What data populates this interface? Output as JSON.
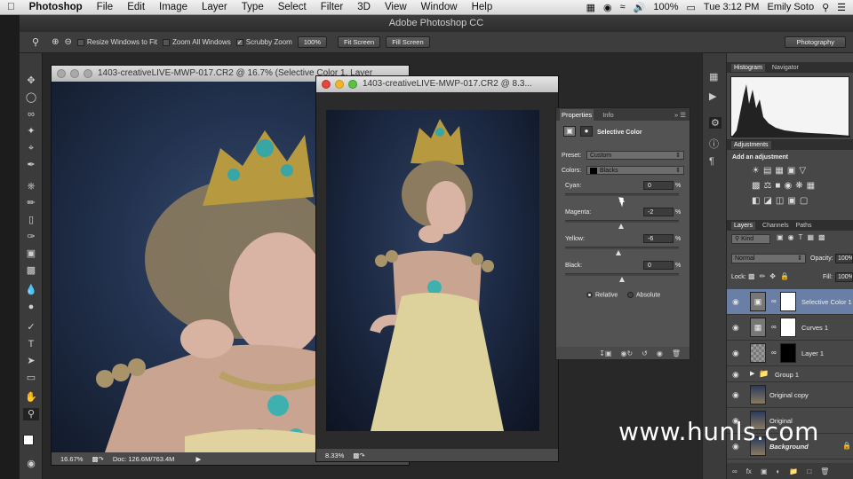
{
  "menubar": {
    "app": "Photoshop",
    "items": [
      "File",
      "Edit",
      "Image",
      "Layer",
      "Type",
      "Select",
      "Filter",
      "3D",
      "View",
      "Window",
      "Help"
    ],
    "battery": "100%",
    "clock": "Tue 3:12 PM",
    "user": "Emily Soto"
  },
  "window_title": "Adobe Photoshop CC",
  "options_bar": {
    "resize_windows": "Resize Windows to Fit",
    "zoom_all": "Zoom All Windows",
    "scrubby_zoom": "Scrubby Zoom",
    "btn_100": "100%",
    "btn_fit": "Fit Screen",
    "btn_fill": "Fill Screen",
    "workspace": "Photography"
  },
  "doc1": {
    "title": "1403-creativeLIVE-MWP-017.CR2 @ 16.7% (Selective Color 1, Layer",
    "zoom": "16.67%",
    "doc_size": "Doc: 126.6M/763.4M"
  },
  "doc2": {
    "title": "1403-creativeLIVE-MWP-017.CR2 @ 8.3...",
    "zoom": "8.33%"
  },
  "properties": {
    "tab_properties": "Properties",
    "tab_info": "Info",
    "heading": "Selective Color",
    "preset_label": "Preset:",
    "preset_value": "Custom",
    "colors_label": "Colors:",
    "colors_value": "Blacks",
    "sliders": [
      {
        "label": "Cyan:",
        "value": "0",
        "pct": "%",
        "pos": 0.5
      },
      {
        "label": "Magenta:",
        "value": "-2",
        "pct": "%",
        "pos": 0.49
      },
      {
        "label": "Yellow:",
        "value": "-6",
        "pct": "%",
        "pos": 0.47
      },
      {
        "label": "Black:",
        "value": "0",
        "pct": "%",
        "pos": 0.5
      }
    ],
    "relative": "Relative",
    "absolute": "Absolute"
  },
  "histogram": {
    "tab_histogram": "Histogram",
    "tab_navigator": "Navigator"
  },
  "adjustments": {
    "title": "Adjustments",
    "add": "Add an adjustment"
  },
  "layers_panel": {
    "tab_layers": "Layers",
    "tab_channels": "Channels",
    "tab_paths": "Paths",
    "kind": "Kind",
    "blend": "Normal",
    "opacity_label": "Opacity:",
    "opacity_value": "100%",
    "lock_label": "Lock:",
    "fill_label": "Fill:",
    "fill_value": "100%",
    "layers": [
      {
        "name": "Selective Color 1"
      },
      {
        "name": "Curves 1"
      },
      {
        "name": "Layer 1"
      },
      {
        "name": "Group 1"
      },
      {
        "name": "Original copy"
      },
      {
        "name": "Original"
      },
      {
        "name": "Background"
      }
    ]
  },
  "watermark": "www.hunls.com"
}
